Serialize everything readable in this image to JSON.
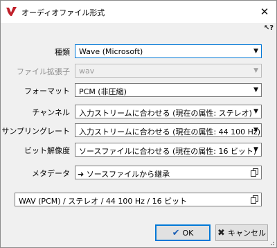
{
  "window": {
    "title": "オーディオファイル形式",
    "close": "✕",
    "help": "↖?"
  },
  "form": {
    "type": {
      "label": "種類",
      "value": "Wave (Microsoft)"
    },
    "extension": {
      "label": "ファイル拡張子",
      "value": "wav"
    },
    "format": {
      "label": "フォーマット",
      "value": "PCM (非圧縮)"
    },
    "channels": {
      "label": "チャンネル",
      "value": "入力ストリームに合わせる (現在の属性: ステレオ)"
    },
    "sample_rate": {
      "label": "サンプリングレート",
      "value": "入力ストリームに合わせる (現在の属性: 44 100 Hz)"
    },
    "bit_depth": {
      "label": "ビット解像度",
      "value": "ソースファイルに合わせる (現在の属性: 16 ビット)"
    },
    "metadata": {
      "label": "メタデータ",
      "value": "ソースファイルから継承"
    }
  },
  "summary": "WAV (PCM) / ステレオ / 44 100 Hz / 16 ビット",
  "buttons": {
    "ok": "OK",
    "cancel": "キャンセル"
  },
  "icons": {
    "app": "app-logo-icon",
    "dropdown": "chevron-down-icon",
    "metadata_arrow": "arrow-right-icon",
    "copy": "copy-icon",
    "ok": "check-icon",
    "cancel": "x-icon"
  },
  "colors": {
    "focus_border": "#0078d7",
    "ok_icon": "#1c5fb5",
    "dialog_bg": "#f0f0f0"
  }
}
